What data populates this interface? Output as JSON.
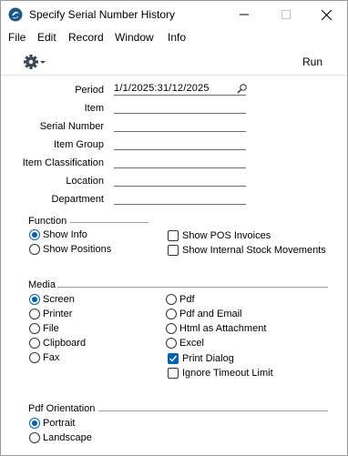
{
  "window": {
    "title": "Specify Serial Number History",
    "icons": {
      "app": "app-logo-icon",
      "minimize": "minimize-icon",
      "maximize": "maximize-icon",
      "close": "close-icon"
    }
  },
  "menu": [
    "File",
    "Edit",
    "Record",
    "Window",
    "Info"
  ],
  "toolbar": {
    "gear_icon": "gear-icon",
    "run_label": "Run"
  },
  "fields": [
    {
      "label": "Period",
      "value": "1/1/2025:31/12/2025"
    },
    {
      "label": "Item",
      "value": ""
    },
    {
      "label": "Serial Number",
      "value": ""
    },
    {
      "label": "Item Group",
      "value": ""
    },
    {
      "label": "Item Classification",
      "value": ""
    },
    {
      "label": "Location",
      "value": ""
    },
    {
      "label": "Department",
      "value": ""
    }
  ],
  "function": {
    "title": "Function",
    "radios": [
      {
        "label": "Show Info",
        "selected": true
      },
      {
        "label": "Show Positions",
        "selected": false
      }
    ],
    "checks": [
      {
        "label": "Show POS Invoices",
        "checked": false
      },
      {
        "label": "Show Internal Stock Movements",
        "checked": false
      }
    ]
  },
  "media": {
    "title": "Media",
    "radios_left": [
      {
        "label": "Screen",
        "selected": true
      },
      {
        "label": "Printer",
        "selected": false
      },
      {
        "label": "File",
        "selected": false
      },
      {
        "label": "Clipboard",
        "selected": false
      },
      {
        "label": "Fax",
        "selected": false
      }
    ],
    "radios_right": [
      {
        "label": "Pdf",
        "selected": false
      },
      {
        "label": "Pdf and Email",
        "selected": false
      },
      {
        "label": "Html as Attachment",
        "selected": false
      },
      {
        "label": "Excel",
        "selected": false
      }
    ],
    "checks": [
      {
        "label": "Print Dialog",
        "checked": true
      },
      {
        "label": "Ignore Timeout Limit",
        "checked": false
      }
    ]
  },
  "pdf_orientation": {
    "title": "Pdf Orientation",
    "radios": [
      {
        "label": "Portrait",
        "selected": true
      },
      {
        "label": "Landscape",
        "selected": false
      }
    ]
  },
  "colors": {
    "accent": "#0063b1",
    "window_bg": "#ffffff",
    "frame": "#f0f0f0"
  }
}
